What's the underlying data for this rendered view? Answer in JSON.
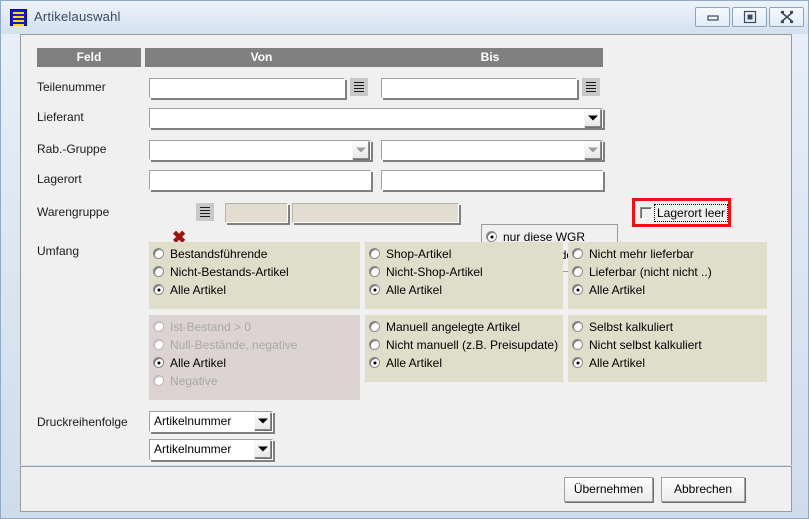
{
  "window": {
    "title": "Artikelauswahl",
    "icon": "list-document-icon",
    "controls": {
      "minimize": "minimize-icon",
      "maximize": "maximize-icon",
      "close": "close-icon"
    }
  },
  "columns": {
    "feld": "Feld",
    "von": "Von",
    "bis": "Bis"
  },
  "rows": {
    "teilenummer": {
      "label": "Teilenummer",
      "von_value": "",
      "bis_value": ""
    },
    "lieferant": {
      "label": "Lieferant",
      "value": ""
    },
    "rabgruppe": {
      "label": "Rab.-Gruppe",
      "von_value": "",
      "bis_value": ""
    },
    "lagerort": {
      "label": "Lagerort",
      "von_value": "",
      "bis_value": ""
    },
    "warengruppe": {
      "label": "Warengruppe",
      "von_value": "",
      "bis_value": ""
    }
  },
  "lagerort_leer": {
    "label": "Lagerort leer",
    "checked": false,
    "highlight_color": "#ee1111"
  },
  "wgr_group": {
    "options": [
      {
        "label": "nur diese WGR",
        "checked": true
      },
      {
        "label": "alle außer der WGR",
        "checked": false
      }
    ]
  },
  "umfang": {
    "label": "Umfang",
    "groups": [
      {
        "name": "bestand-group",
        "enabled": true,
        "options": [
          {
            "label": "Bestandsführende",
            "checked": false
          },
          {
            "label": "Nicht-Bestands-Artikel",
            "checked": false
          },
          {
            "label": "Alle Artikel",
            "checked": true
          }
        ]
      },
      {
        "name": "shop-group",
        "enabled": true,
        "options": [
          {
            "label": "Shop-Artikel",
            "checked": false
          },
          {
            "label": "Nicht-Shop-Artikel",
            "checked": false
          },
          {
            "label": "Alle Artikel",
            "checked": true
          }
        ]
      },
      {
        "name": "lieferbar-group",
        "enabled": true,
        "options": [
          {
            "label": "Nicht mehr lieferbar",
            "checked": false
          },
          {
            "label": "Lieferbar (nicht nicht ..)",
            "checked": false
          },
          {
            "label": "Alle Artikel",
            "checked": true
          }
        ]
      },
      {
        "name": "ist-bestand-group",
        "enabled": false,
        "options": [
          {
            "label": "Ist-Bestand > 0",
            "checked": false,
            "disabled": true
          },
          {
            "label": "Null-Bestände, negative",
            "checked": false,
            "disabled": true
          },
          {
            "label": "Alle Artikel",
            "checked": true,
            "disabled": false
          },
          {
            "label": "Negative",
            "checked": false,
            "disabled": true
          }
        ]
      },
      {
        "name": "manuell-group",
        "enabled": true,
        "options": [
          {
            "label": "Manuell angelegte Artikel",
            "checked": false
          },
          {
            "label": "Nicht manuell (z.B. Preisupdate)",
            "checked": false
          },
          {
            "label": "Alle Artikel",
            "checked": true
          }
        ]
      },
      {
        "name": "kalkuliert-group",
        "enabled": true,
        "options": [
          {
            "label": "Selbst kalkuliert",
            "checked": false
          },
          {
            "label": "Nicht selbst kalkuliert",
            "checked": false
          },
          {
            "label": "Alle Artikel",
            "checked": true
          }
        ]
      }
    ]
  },
  "druckreihenfolge": {
    "label": "Druckreihenfolge",
    "select1": "Artikelnummer",
    "select2": "Artikelnummer"
  },
  "footer": {
    "apply": "Übernehmen",
    "cancel": "Abbrechen"
  },
  "icons": {
    "list_button": "list-lines-icon",
    "clear_x": "✖"
  }
}
